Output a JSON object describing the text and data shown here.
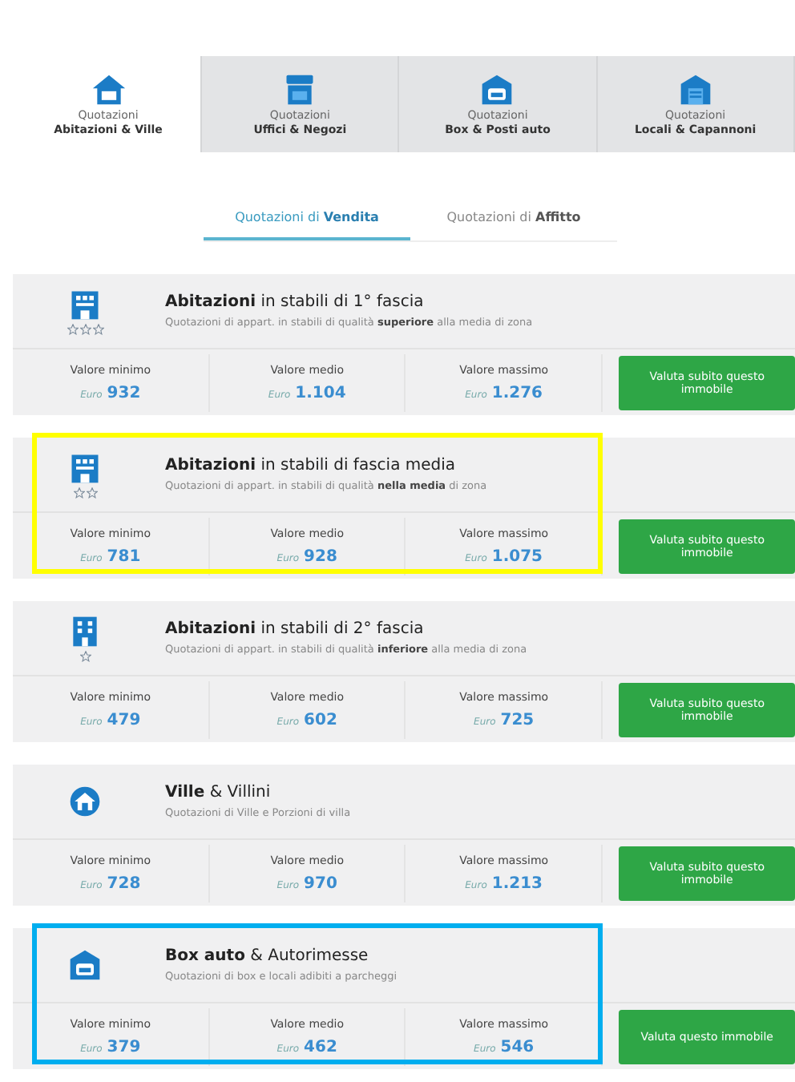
{
  "categories": [
    {
      "kind": "house",
      "caption": "Quotazioni",
      "label": "Abitazioni & Ville",
      "selected": true
    },
    {
      "kind": "shop",
      "caption": "Quotazioni",
      "label": "Uffici & Negozi",
      "selected": false
    },
    {
      "kind": "garage",
      "caption": "Quotazioni",
      "label": "Box & Posti auto",
      "selected": false
    },
    {
      "kind": "warehouse",
      "caption": "Quotazioni",
      "label": "Locali & Capannoni",
      "selected": false
    }
  ],
  "subtabs": [
    {
      "label": "Quotazioni di **Vendita**",
      "selected": true
    },
    {
      "label": "Quotazioni di **Affitto**",
      "selected": false
    }
  ],
  "cards": [
    {
      "kind": "apartment",
      "rating_stars": [
        {
          "filled": false
        },
        {
          "filled": false
        },
        {
          "filled": false
        }
      ],
      "title": "**Abitazioni** in stabili di 1° fascia",
      "description": "Quotazioni di appart. in stabili di qualità **superiore** alla media di zona",
      "values": [
        {
          "label": "Valore minimo",
          "currency": "Euro",
          "amount": "932"
        },
        {
          "label": "Valore medio",
          "currency": "Euro",
          "amount": "1.104"
        },
        {
          "label": "Valore massimo",
          "currency": "Euro",
          "amount": "1.276"
        }
      ],
      "button": "Valuta subito questo immobile"
    },
    {
      "kind": "apartment",
      "rating_stars": [
        {
          "filled": false
        },
        {
          "filled": false
        }
      ],
      "color": "#ffff00",
      "title": "**Abitazioni** in stabili di fascia media",
      "description": "Quotazioni di appart. in stabili di qualità **nella media** di zona",
      "values": [
        {
          "label": "Valore minimo",
          "currency": "Euro",
          "amount": "781"
        },
        {
          "label": "Valore medio",
          "currency": "Euro",
          "amount": "928"
        },
        {
          "label": "Valore massimo",
          "currency": "Euro",
          "amount": "1.075"
        }
      ],
      "button": "Valuta subito questo immobile"
    },
    {
      "kind": "building",
      "rating_stars": [
        {
          "filled": false
        }
      ],
      "title": "**Abitazioni** in stabili di 2° fascia",
      "description": "Quotazioni di appart. in stabili di qualità **inferiore** alla media di zona",
      "values": [
        {
          "label": "Valore minimo",
          "currency": "Euro",
          "amount": "479"
        },
        {
          "label": "Valore medio",
          "currency": "Euro",
          "amount": "602"
        },
        {
          "label": "Valore massimo",
          "currency": "Euro",
          "amount": "725"
        }
      ],
      "button": "Valuta subito questo immobile"
    },
    {
      "kind": "villa",
      "title": "**Ville** & Villini",
      "description": "Quotazioni di Ville e Porzioni di villa",
      "values": [
        {
          "label": "Valore minimo",
          "currency": "Euro",
          "amount": "728"
        },
        {
          "label": "Valore medio",
          "currency": "Euro",
          "amount": "970"
        },
        {
          "label": "Valore massimo",
          "currency": "Euro",
          "amount": "1.213"
        }
      ],
      "button": "Valuta subito questo immobile"
    },
    {
      "kind": "garage",
      "color": "#00aeef",
      "title": "**Box auto** & Autorimesse",
      "description": "Quotazioni di box e locali adibiti a parcheggi",
      "values": [
        {
          "label": "Valore minimo",
          "currency": "Euro",
          "amount": "379"
        },
        {
          "label": "Valore medio",
          "currency": "Euro",
          "amount": "462"
        },
        {
          "label": "Valore massimo",
          "currency": "Euro",
          "amount": "546"
        }
      ],
      "button": "Valuta questo immobile"
    }
  ]
}
